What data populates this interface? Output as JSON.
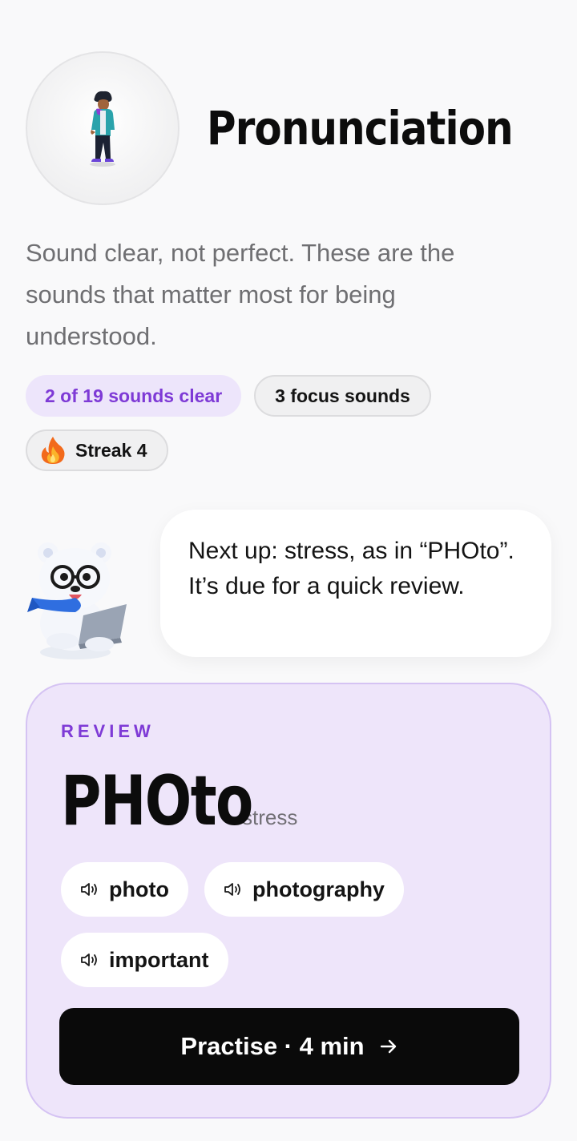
{
  "header": {
    "title": "Pronunciation",
    "avatar_icon": "person-illustration-icon"
  },
  "subtitle": "Sound clear, not perfect. These are the sounds that matter most for being understood.",
  "chips": {
    "progress": "2 of 19 sounds clear",
    "focus": "3 focus sounds",
    "streak": "Streak 4",
    "streak_icon": "flame-icon"
  },
  "coach": {
    "mascot_icon": "polar-bear-mascot-icon",
    "message": "Next up: stress, as in “PHOto”. It’s due for a quick review."
  },
  "review_card": {
    "eyebrow": "REVIEW",
    "word": "PHOto",
    "tag": "stress",
    "examples": [
      {
        "label": "photo",
        "icon": "speaker-icon"
      },
      {
        "label": "photography",
        "icon": "speaker-icon"
      },
      {
        "label": "important",
        "icon": "speaker-icon"
      }
    ],
    "cta_label": "Practise · 4 min",
    "cta_icon": "arrow-right-icon"
  },
  "colors": {
    "accent": "#7e3ad6",
    "card_bg": "#eee5fa",
    "chip_purple_bg": "#ede5fb",
    "cta_bg": "#0a0a0a",
    "page_bg": "#f9f9fa"
  }
}
